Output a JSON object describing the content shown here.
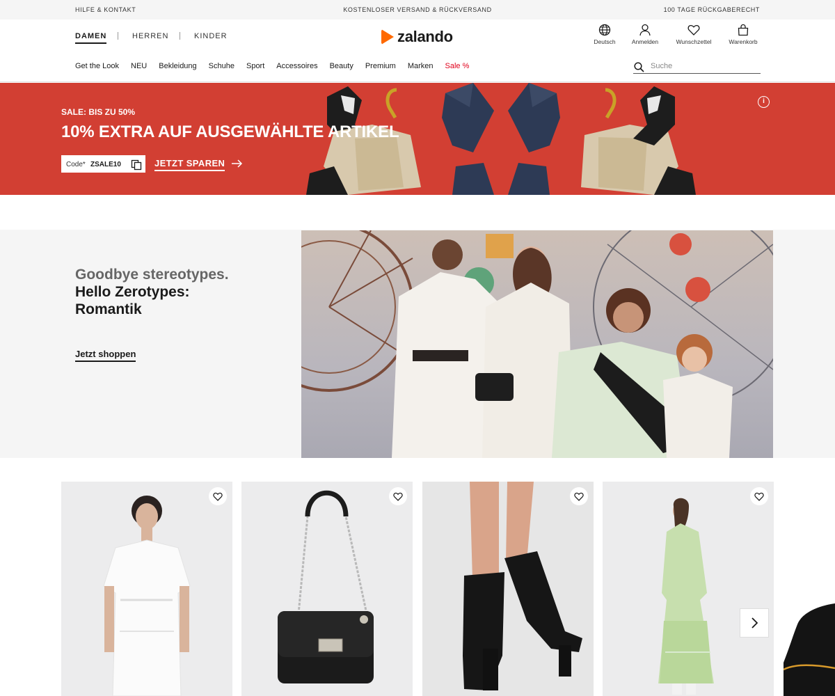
{
  "topbar": {
    "left": "HILFE & KONTAKT",
    "center": "KOSTENLOSER VERSAND & RÜCKVERSAND",
    "right": "100 TAGE RÜCKGABERECHT"
  },
  "header": {
    "genders": [
      {
        "label": "DAMEN",
        "active": true
      },
      {
        "label": "HERREN",
        "active": false
      },
      {
        "label": "KINDER",
        "active": false
      }
    ],
    "logo": "zalando",
    "icons": [
      {
        "label": "Deutsch",
        "icon": "globe-icon"
      },
      {
        "label": "Anmelden",
        "icon": "user-icon"
      },
      {
        "label": "Wunschzettel",
        "icon": "heart-icon"
      },
      {
        "label": "Warenkorb",
        "icon": "bag-icon"
      }
    ],
    "categories": [
      "Get the Look",
      "NEU",
      "Bekleidung",
      "Schuhe",
      "Sport",
      "Accessoires",
      "Beauty",
      "Premium",
      "Marken",
      "Sale %"
    ],
    "search": {
      "placeholder": "Suche",
      "value": ""
    }
  },
  "banner": {
    "eyebrow": "SALE: BIS ZU 50%",
    "headline": "10% EXTRA AUF AUSGEWÄHLTE ARTIKEL",
    "code_label": "Code*",
    "code_value": "ZSALE10",
    "cta": "JETZT SPAREN",
    "info": "i",
    "background": "#d23f33"
  },
  "editorial": {
    "line1": "Goodbye stereotypes.",
    "line2": "Hello Zerotypes:",
    "line3": "Romantik",
    "cta": "Jetzt shoppen"
  },
  "products": [
    {
      "name": "white-lace-dress"
    },
    {
      "name": "black-quilted-handbag"
    },
    {
      "name": "black-ankle-boots"
    },
    {
      "name": "green-lace-maxi-dress"
    }
  ],
  "colors": {
    "brand": "#ff6900",
    "sale": "#e0001b"
  }
}
